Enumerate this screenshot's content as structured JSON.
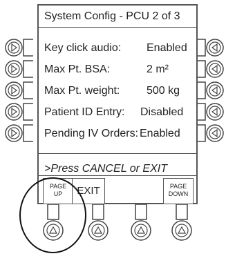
{
  "screen": {
    "title": "System Config - PCU 2 of 3",
    "rows": [
      {
        "label": "Key click audio:",
        "value": "Enabled"
      },
      {
        "label": "Max Pt. BSA:",
        "value": "2 m²"
      },
      {
        "label": "Max Pt. weight:",
        "value": "500 kg"
      },
      {
        "label": "Patient ID Entry:",
        "value": "Disabled"
      },
      {
        "label": "Pending IV Orders:",
        "value": "Enabled"
      }
    ],
    "prompt": ">Press CANCEL or EXIT"
  },
  "softkeys": {
    "page_up_line1": "PAGE",
    "page_up_line2": "UP",
    "exit": "EXIT",
    "page_down_line1": "PAGE",
    "page_down_line2": "DOWN"
  },
  "icons": {
    "left_side_buttons": "triangle-right-icon",
    "right_side_buttons": "triangle-left-icon",
    "bottom_buttons": "triangle-up-icon"
  }
}
